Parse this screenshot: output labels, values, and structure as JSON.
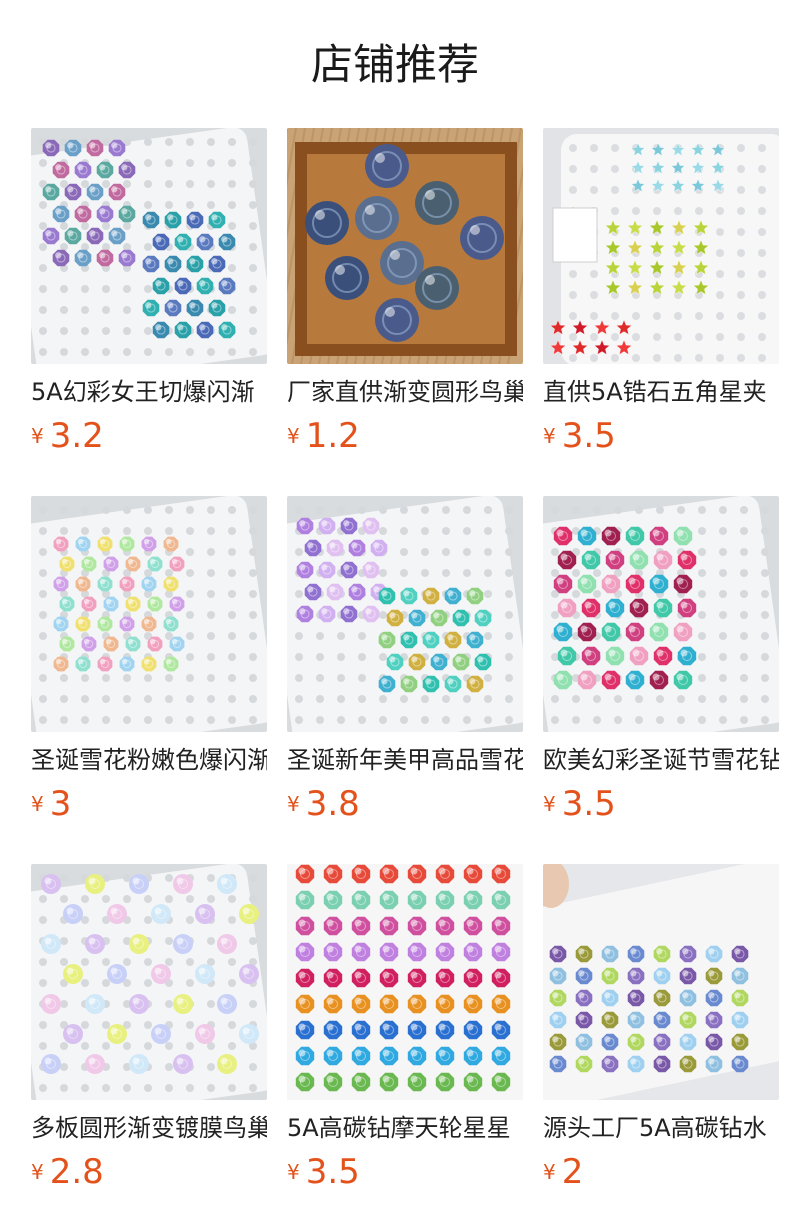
{
  "header": {
    "title": "店铺推荐"
  },
  "products": [
    {
      "name": "5A幻彩女王切爆闪渐",
      "currency": "¥",
      "price": "3.2",
      "image": "tray-octagon-gems-blue-purple"
    },
    {
      "name": "厂家直供渐变圆形鸟巢",
      "currency": "¥",
      "price": "1.2",
      "image": "wood-box-round-gems"
    },
    {
      "name": "直供5A锆石五角星夹",
      "currency": "¥",
      "price": "3.5",
      "image": "tray-star-gems"
    },
    {
      "name": "圣诞雪花粉嫩色爆闪渐",
      "currency": "¥",
      "price": "3",
      "image": "tray-snowflake-pastel"
    },
    {
      "name": "圣诞新年美甲高品雪花",
      "currency": "¥",
      "price": "3.8",
      "image": "tray-snowflake-purple-teal"
    },
    {
      "name": "欧美幻彩圣诞节雪花钻",
      "currency": "¥",
      "price": "3.5",
      "image": "tray-snowflake-red-teal"
    },
    {
      "name": "多板圆形渐变镀膜鸟巢",
      "currency": "¥",
      "price": "2.8",
      "image": "tray-round-ab-gems"
    },
    {
      "name": "5A高碳钻摩天轮星星",
      "currency": "¥",
      "price": "3.5",
      "image": "grid-colored-gems"
    },
    {
      "name": "源头工厂5A高碳钻水",
      "currency": "¥",
      "price": "2",
      "image": "tray-mixed-gems"
    }
  ]
}
